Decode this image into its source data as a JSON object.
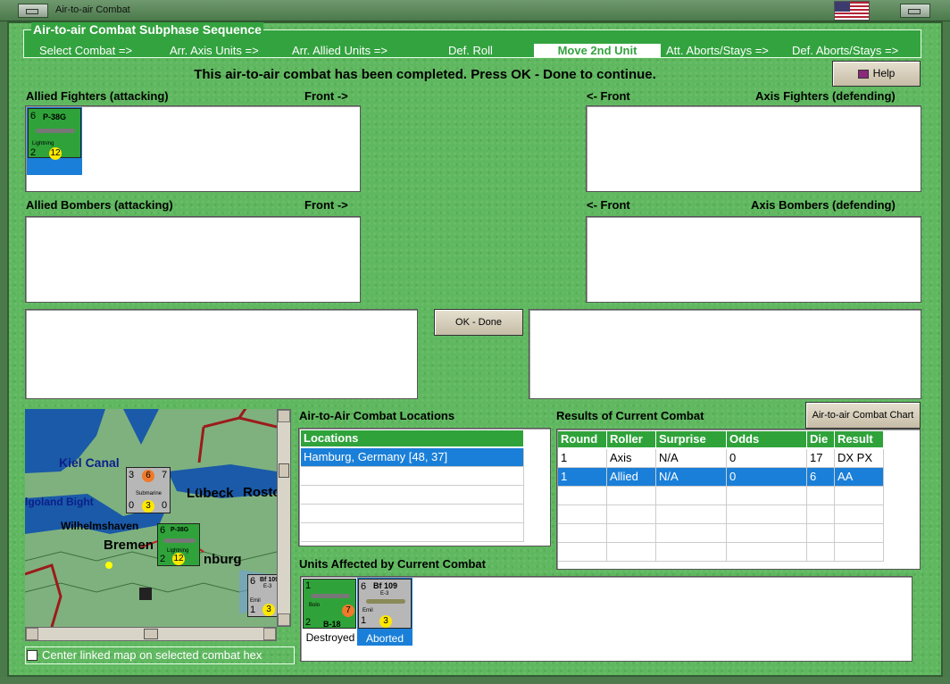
{
  "window": {
    "title": "Air-to-air Combat"
  },
  "sequence": {
    "title": "Air-to-air Combat Subphase Sequence",
    "steps": [
      "Select Combat =>",
      "Arr. Axis Units =>",
      "Arr. Allied Units =>",
      "Def. Roll",
      "Move 2nd Unit",
      "Att. Aborts/Stays =>",
      "Def. Aborts/Stays =>"
    ],
    "active": "Move 2nd Unit"
  },
  "message": "This air-to-air combat has been completed.  Press OK - Done to continue.",
  "help_label": "Help",
  "panels": {
    "allied_fighters": "Allied Fighters (attacking)",
    "front_right": "Front ->",
    "front_left": "<- Front",
    "axis_fighters": "Axis Fighters (defending)",
    "allied_bombers": "Allied Bombers (attacking)",
    "axis_bombers": "Axis Bombers (defending)"
  },
  "ok_done_label": "OK - Done",
  "allied_fighter_unit": {
    "type": "P-38G",
    "name": "Lightning",
    "top_left": "6",
    "bottom_left": "2",
    "die": "12"
  },
  "map": {
    "labels": {
      "kiel": "Kiel Canal",
      "helgoland": "lgoland Bight",
      "lubeck": "Lübeck",
      "rostock": "Rosto",
      "wilhelmshaven": "Wilhelmshaven",
      "bremen": "Bremen",
      "hamburg": "nburg"
    },
    "sub_unit": {
      "name": "Submarine",
      "tl": "3",
      "tr": "7",
      "bl": "0",
      "br": "0",
      "die_top": "6",
      "die": "3"
    },
    "p38_unit": {
      "type": "P-38G",
      "name": "Lightning",
      "tl": "6",
      "bl": "2",
      "die": "12"
    },
    "bf_unit": {
      "type": "Bf 109",
      "sub": "E-3",
      "name": "Emil",
      "tl": "6",
      "bl": "1",
      "die": "3"
    }
  },
  "center_map_label": "Center linked map on selected combat hex",
  "locations": {
    "title": "Air-to-Air Combat Locations",
    "header": "Locations",
    "rows": [
      "Hamburg, Germany [48, 37]"
    ]
  },
  "results": {
    "title": "Results of Current Combat",
    "chart_button": "Air-to-air Combat Chart",
    "headers": [
      "Round",
      "Roller",
      "Surprise",
      "Odds",
      "Die",
      "Result"
    ],
    "rows": [
      [
        "1",
        "Axis",
        "N/A",
        "0",
        "17",
        "DX PX"
      ],
      [
        "1",
        "Allied",
        "N/A",
        "0",
        "6",
        "AA"
      ]
    ]
  },
  "affected": {
    "title": "Units Affected by Current Combat",
    "units": [
      {
        "name": "Bolo",
        "type": "B-18",
        "tl": "1",
        "bl": "2",
        "die": "7",
        "status": "Destroyed"
      },
      {
        "name": "Emil",
        "type": "Bf 109",
        "sub": "E-3",
        "tl": "6",
        "bl": "1",
        "die": "3",
        "status": "Aborted"
      }
    ]
  },
  "colors": {
    "panel_green": "#5fb85f",
    "header_green": "#2fa33a",
    "selection_blue": "#1a7fd8",
    "die_yellow": "#ffe800"
  }
}
